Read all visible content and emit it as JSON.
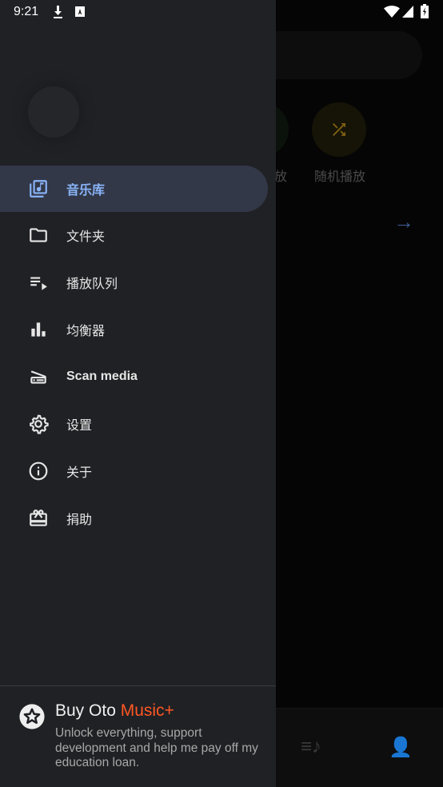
{
  "status_bar": {
    "time": "9:21",
    "icons": [
      "download-icon",
      "keyboard-a-icon",
      "wifi-icon",
      "signal-icon",
      "battery-charging-icon"
    ]
  },
  "background": {
    "partial_label": "放",
    "shuffle_label": "随机播放",
    "colors": {
      "shuffle": "#8a6a12"
    }
  },
  "drawer": {
    "items": [
      {
        "label": "音乐库",
        "icon": "library-music-icon",
        "selected": true
      },
      {
        "label": "文件夹",
        "icon": "folder-icon"
      },
      {
        "label": "播放队列",
        "icon": "queue-icon"
      },
      {
        "label": "均衡器",
        "icon": "equalizer-icon"
      },
      {
        "label": "Scan media",
        "icon": "scanner-icon"
      },
      {
        "label": "设置",
        "icon": "gear-icon"
      },
      {
        "label": "关于",
        "icon": "info-icon"
      },
      {
        "label": "捐助",
        "icon": "gift-icon"
      }
    ],
    "promo": {
      "title": "Buy Oto ",
      "title_accent": "Music+",
      "subtitle": "Unlock everything, support development and help me pay off my education loan."
    },
    "colors": {
      "accent": "#8ab4f8",
      "promo_accent": "#ff5722",
      "selected_bg": "#323848"
    }
  }
}
